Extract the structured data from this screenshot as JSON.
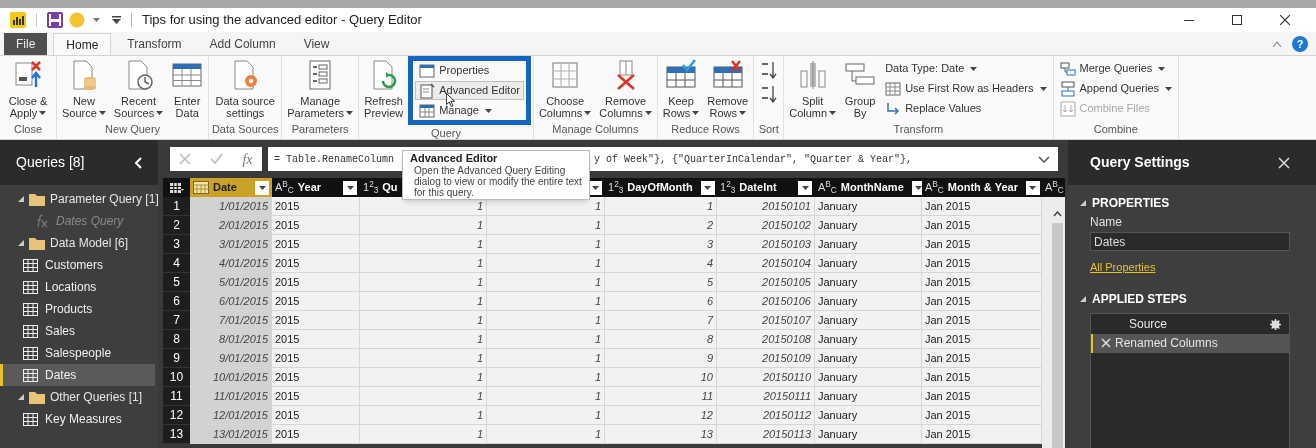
{
  "window": {
    "title": "Tips for using the advanced editor - Query Editor"
  },
  "tabs": [
    {
      "label": "File",
      "kind": "file",
      "selected": false
    },
    {
      "label": "Home",
      "kind": "tab",
      "selected": true
    },
    {
      "label": "Transform",
      "kind": "tab",
      "selected": false
    },
    {
      "label": "Add Column",
      "kind": "tab",
      "selected": false
    },
    {
      "label": "View",
      "kind": "tab",
      "selected": false
    }
  ],
  "help": "?",
  "ribbon": [
    {
      "label": "Close",
      "items": [
        {
          "kind": "large",
          "lines": [
            "Close &",
            "Apply"
          ],
          "dropdown": true
        }
      ]
    },
    {
      "label": "New Query",
      "items": [
        {
          "kind": "large",
          "lines": [
            "New",
            "Source"
          ],
          "dropdown": true
        },
        {
          "kind": "large",
          "lines": [
            "Recent",
            "Sources"
          ],
          "dropdown": true
        },
        {
          "kind": "large",
          "lines": [
            "Enter",
            "Data"
          ],
          "dropdown": false
        }
      ]
    },
    {
      "label": "Data Sources",
      "items": [
        {
          "kind": "large",
          "lines": [
            "Data source",
            "settings"
          ],
          "dropdown": false
        }
      ]
    },
    {
      "label": "Parameters",
      "items": [
        {
          "kind": "large",
          "lines": [
            "Manage",
            "Parameters"
          ],
          "dropdown": true
        }
      ]
    },
    {
      "label": "Query",
      "items": [
        {
          "kind": "large",
          "lines": [
            "Refresh",
            "Preview"
          ],
          "dropdown": false
        },
        {
          "kind": "stack",
          "highlighted": true,
          "items": [
            {
              "label": "Properties",
              "dropdown": false,
              "hovered": false,
              "disabled": false
            },
            {
              "label": "Advanced Editor",
              "dropdown": false,
              "hovered": true,
              "disabled": false
            },
            {
              "label": "Manage",
              "dropdown": true,
              "hovered": false,
              "disabled": false
            }
          ]
        }
      ]
    },
    {
      "label": "Manage Columns",
      "items": [
        {
          "kind": "large",
          "lines": [
            "Choose",
            "Columns"
          ],
          "dropdown": true
        },
        {
          "kind": "large",
          "lines": [
            "Remove",
            "Columns"
          ],
          "dropdown": true
        }
      ]
    },
    {
      "label": "Reduce Rows",
      "items": [
        {
          "kind": "large",
          "lines": [
            "Keep",
            "Rows"
          ],
          "dropdown": true
        },
        {
          "kind": "large",
          "lines": [
            "Remove",
            "Rows"
          ],
          "dropdown": true
        }
      ]
    },
    {
      "label": "Sort",
      "items": [
        {
          "kind": "sort"
        }
      ]
    },
    {
      "label": "Transform",
      "items": [
        {
          "kind": "large",
          "lines": [
            "Split",
            "Column"
          ],
          "dropdown": true
        },
        {
          "kind": "large",
          "lines": [
            "Group",
            "By"
          ],
          "dropdown": false
        },
        {
          "kind": "stack",
          "highlighted": false,
          "items": [
            {
              "label": "Data Type: Date",
              "dropdown": true,
              "hovered": false,
              "disabled": false
            },
            {
              "label": "Use First Row as Headers",
              "dropdown": true,
              "hovered": false,
              "disabled": false
            },
            {
              "label": "Replace Values",
              "dropdown": false,
              "hovered": false,
              "disabled": false
            }
          ]
        }
      ]
    },
    {
      "label": "Combine",
      "items": [
        {
          "kind": "stack",
          "highlighted": false,
          "items": [
            {
              "label": "Merge Queries",
              "dropdown": true,
              "hovered": false,
              "disabled": false
            },
            {
              "label": "Append Queries",
              "dropdown": true,
              "hovered": false,
              "disabled": false
            },
            {
              "label": "Combine Files",
              "dropdown": false,
              "hovered": false,
              "disabled": true
            }
          ]
        }
      ]
    }
  ],
  "tooltip": {
    "title": "Advanced Editor",
    "text": "Open the Advanced Query Editing dialog to view or modify the entire text for this query."
  },
  "queries": {
    "title": "Queries [8]",
    "groups": [
      {
        "label": "Parameter Query [1]",
        "expanded": true,
        "children": [
          {
            "label": "Dates Query",
            "kind": "parameter",
            "selected": false
          }
        ]
      },
      {
        "label": "Data Model [6]",
        "expanded": true,
        "children": [
          {
            "label": "Customers",
            "kind": "table",
            "selected": false
          },
          {
            "label": "Locations",
            "kind": "table",
            "selected": false
          },
          {
            "label": "Products",
            "kind": "table",
            "selected": false
          },
          {
            "label": "Sales",
            "kind": "table",
            "selected": false
          },
          {
            "label": "Salespeople",
            "kind": "table",
            "selected": false
          },
          {
            "label": "Dates",
            "kind": "table",
            "selected": true
          }
        ]
      },
      {
        "label": "Other Queries [1]",
        "expanded": true,
        "children": [
          {
            "label": "Key Measures",
            "kind": "table",
            "selected": false
          }
        ]
      }
    ]
  },
  "formula_bar": {
    "fx": "fx",
    "text_before": "= Table.RenameColumn",
    "text_after": "y of Week\"}, {\"QuarterInCalendar\", \"Quarter & Year\"},"
  },
  "table": {
    "columns": [
      {
        "kind": "date",
        "name": "Date",
        "selected": true,
        "dropdown": true
      },
      {
        "kind": "text",
        "type_label": "A$^{B}$$_{C}$",
        "name": "Year",
        "selected": false,
        "dropdown": true
      },
      {
        "kind": "number",
        "type_label": "1$^{2}$$_{3}$",
        "name": "Qu",
        "selected": false
      },
      {
        "kind": "number",
        "selected": false,
        "dropdown": true
      },
      {
        "kind": "number",
        "type_label": "1$^{2}$$_{3}$",
        "name": "DayOfMonth",
        "selected": false,
        "dropdown": true
      },
      {
        "kind": "number",
        "type_label": "1$^{2}$$_{3}$",
        "name": "DateInt",
        "selected": false,
        "dropdown": true
      },
      {
        "kind": "text",
        "type_label": "A$^{B}$$_{C}$",
        "name": "MonthName",
        "selected": false,
        "dropdown": true
      },
      {
        "kind": "text",
        "type_label": "A$^{B}$$_{C}$",
        "name": "Month & Year",
        "selected": false,
        "dropdown": true
      },
      {
        "kind": "text",
        "type_label": "A$^{B}$$_{C}$",
        "selected": false
      }
    ],
    "rows": [
      {
        "index": "1",
        "cells": [
          "1/01/2015",
          "2015",
          "1",
          "1",
          "1",
          "20150101",
          "January",
          "Jan 2015"
        ]
      },
      {
        "index": "2",
        "cells": [
          "2/01/2015",
          "2015",
          "1",
          "1",
          "2",
          "20150102",
          "January",
          "Jan 2015"
        ]
      },
      {
        "index": "3",
        "cells": [
          "3/01/2015",
          "2015",
          "1",
          "1",
          "3",
          "20150103",
          "January",
          "Jan 2015"
        ]
      },
      {
        "index": "4",
        "cells": [
          "4/01/2015",
          "2015",
          "1",
          "1",
          "4",
          "20150104",
          "January",
          "Jan 2015"
        ]
      },
      {
        "index": "5",
        "cells": [
          "5/01/2015",
          "2015",
          "1",
          "1",
          "5",
          "20150105",
          "January",
          "Jan 2015"
        ]
      },
      {
        "index": "6",
        "cells": [
          "6/01/2015",
          "2015",
          "1",
          "1",
          "6",
          "20150106",
          "January",
          "Jan 2015"
        ]
      },
      {
        "index": "7",
        "cells": [
          "7/01/2015",
          "2015",
          "1",
          "1",
          "7",
          "20150107",
          "January",
          "Jan 2015"
        ]
      },
      {
        "index": "8",
        "cells": [
          "8/01/2015",
          "2015",
          "1",
          "1",
          "8",
          "20150108",
          "January",
          "Jan 2015"
        ]
      },
      {
        "index": "9",
        "cells": [
          "9/01/2015",
          "2015",
          "1",
          "1",
          "9",
          "20150109",
          "January",
          "Jan 2015"
        ]
      },
      {
        "index": "10",
        "cells": [
          "10/01/2015",
          "2015",
          "1",
          "1",
          "10",
          "20150110",
          "January",
          "Jan 2015"
        ]
      },
      {
        "index": "11",
        "cells": [
          "11/01/2015",
          "2015",
          "1",
          "1",
          "11",
          "20150111",
          "January",
          "Jan 2015"
        ]
      },
      {
        "index": "12",
        "cells": [
          "12/01/2015",
          "2015",
          "1",
          "1",
          "12",
          "20150112",
          "January",
          "Jan 2015"
        ]
      },
      {
        "index": "13",
        "cells": [
          "13/01/2015",
          "2015",
          "1",
          "1",
          "13",
          "20150113",
          "January",
          "Jan 2015"
        ]
      }
    ]
  },
  "query_settings": {
    "title": "Query Settings",
    "properties": {
      "heading": "PROPERTIES",
      "expanded": true,
      "name_label": "Name",
      "name_value": "Dates",
      "link": "All Properties"
    },
    "applied_steps": {
      "heading": "APPLIED STEPS",
      "expanded": true,
      "steps": [
        {
          "label": "Source",
          "selected": false,
          "has_settings": true
        },
        {
          "label": "Renamed Columns",
          "selected": true,
          "has_settings": false
        }
      ]
    }
  }
}
